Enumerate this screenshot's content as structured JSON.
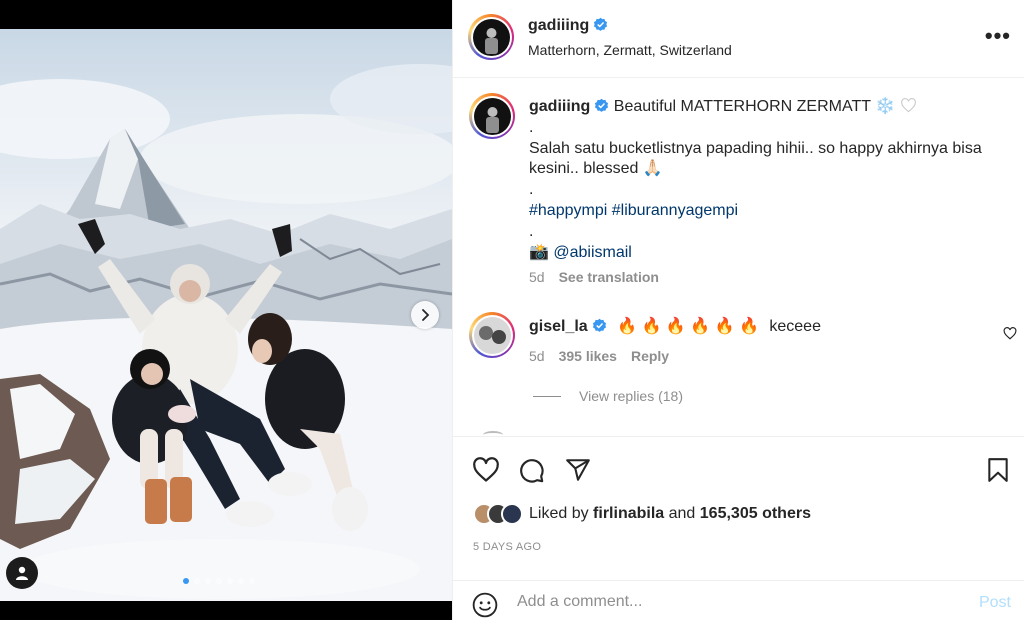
{
  "post": {
    "author": {
      "username": "gadiiing",
      "verified": true,
      "location": "Matterhorn, Zermatt, Switzerland"
    },
    "caption": {
      "title": "Beautiful MATTERHORN ZERMATT",
      "title_emojis": "❄️",
      "line_dot1": ".",
      "body": "Salah satu bucketlistnya papading hihii.. so happy akhirnya bisa kesini.. blessed",
      "body_emoji": "🙏🏻",
      "line_dot2": ".",
      "hashtag1": "#happympi",
      "hashtag2": "#liburannyagempi",
      "line_dot3": ".",
      "camera_emoji": "📸",
      "mention": "@abiismail",
      "age": "5d",
      "see_translation": "See translation"
    },
    "comment": {
      "username": "gisel_la",
      "verified": true,
      "fire_emojis": "🔥 🔥 🔥 🔥 🔥 🔥",
      "text": "keceee",
      "age": "5d",
      "likes": "395 likes",
      "reply": "Reply",
      "view_replies": "View replies (18)"
    },
    "likes": {
      "prefix": "Liked by",
      "liker": "firlinabila",
      "joiner": "and",
      "others": "165,305 others"
    },
    "date": "5 DAYS AGO",
    "carousel": {
      "total": 7,
      "active_index": 0
    }
  },
  "add_comment": {
    "placeholder": "Add a comment...",
    "post_label": "Post"
  },
  "icons": {
    "more": "more-options-icon",
    "like": "heart-icon",
    "comment": "comment-icon",
    "share": "share-icon",
    "save": "bookmark-icon",
    "emoji": "emoji-icon",
    "next": "chevron-right-icon",
    "tag": "user-tag-icon"
  },
  "colors": {
    "link": "#00376b",
    "verified": "#3897f0",
    "muted": "#8e8e8e",
    "post_disabled": "#b2dffc"
  }
}
